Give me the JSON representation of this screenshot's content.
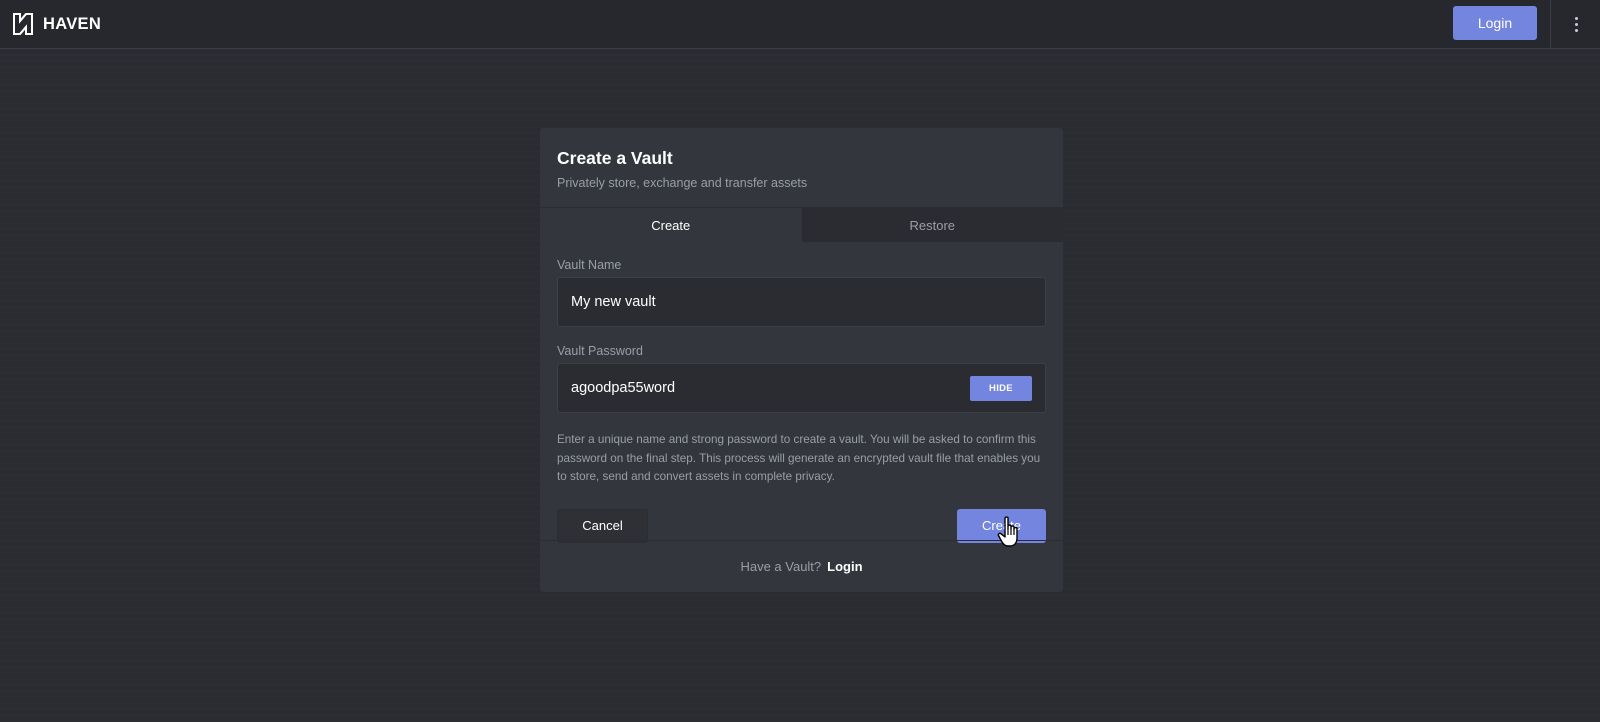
{
  "app": {
    "brand": "HAVEN",
    "login_label": "Login"
  },
  "card": {
    "title": "Create a Vault",
    "subtitle": "Privately store, exchange and transfer assets",
    "tabs": [
      {
        "label": "Create",
        "active": true
      },
      {
        "label": "Restore",
        "active": false
      }
    ],
    "vault_name": {
      "label": "Vault Name",
      "value": "My new vault"
    },
    "vault_password": {
      "label": "Vault Password",
      "value": "agoodpa55word",
      "toggle_label": "HIDE"
    },
    "help_text": "Enter a unique name and strong password to create a vault. You will be asked to confirm this password on the final step. This process will generate an encrypted vault file that enables you to store, send and convert assets in complete privacy.",
    "cancel_label": "Cancel",
    "create_label": "Create",
    "footer": {
      "question": "Have a Vault?",
      "login_label": "Login"
    }
  },
  "colors": {
    "accent": "#7385de",
    "background": "#2a2c31",
    "card": "#33363d"
  }
}
